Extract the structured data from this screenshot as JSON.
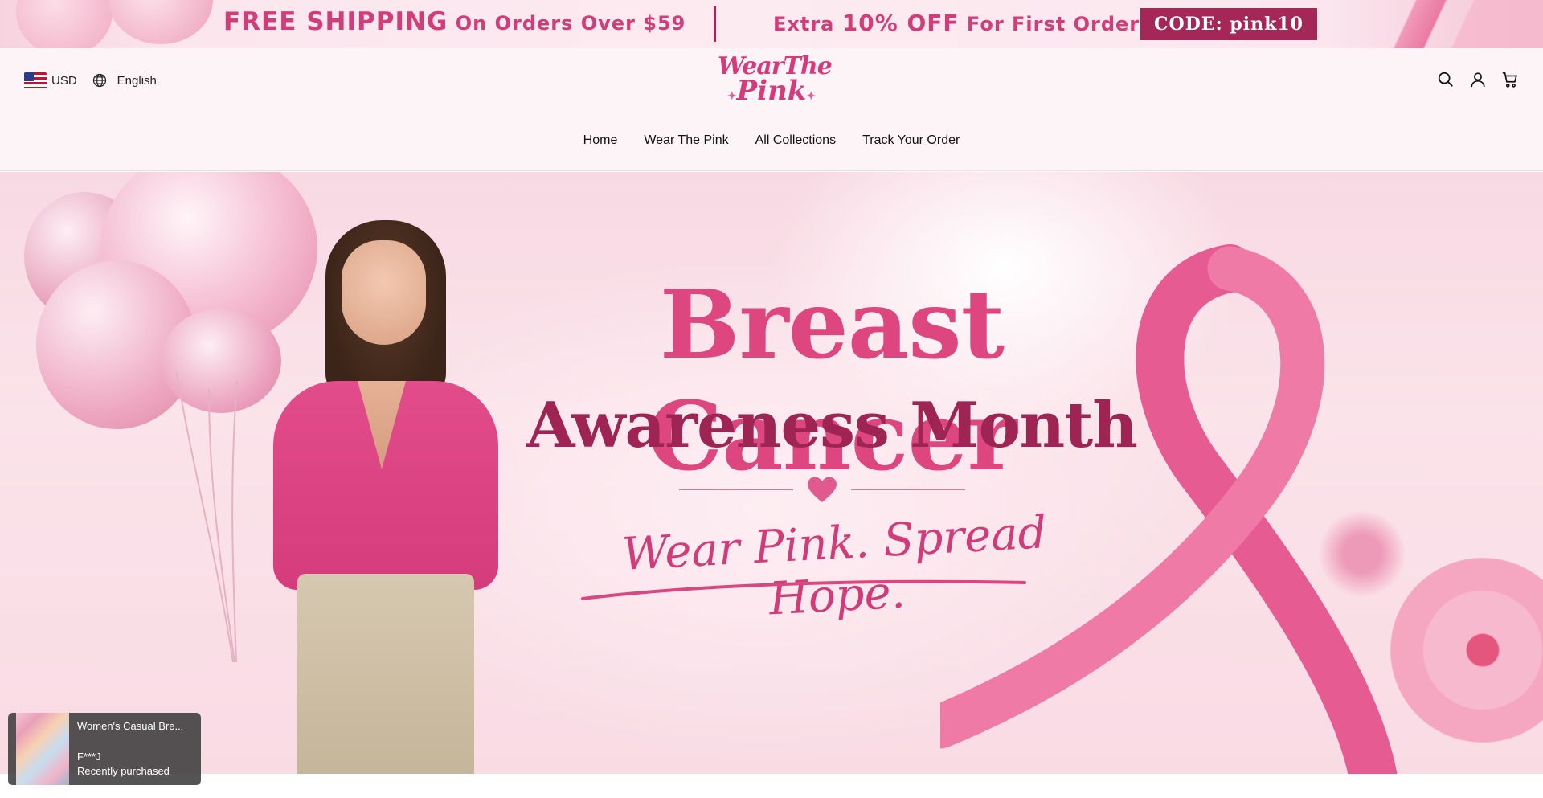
{
  "announcement": {
    "shipping_big": "FREE SHIPPING",
    "shipping_small": " On Orders Over $59",
    "discount_small1": "Extra ",
    "discount_big": "10% OFF",
    "discount_small2": " For First Order",
    "code": "CODE: pink10"
  },
  "header": {
    "currency": "USD",
    "language": "English",
    "logo_line1": "WearThe",
    "logo_line2": "Pink"
  },
  "nav": {
    "items": [
      "Home",
      "Wear The Pink",
      "All Collections",
      "Track Your Order"
    ]
  },
  "hero": {
    "title": "Breast Cancer",
    "subtitle": "Awareness Month",
    "tagline": "Wear Pink. Spread Hope."
  },
  "popup": {
    "product": "Women's Casual Bre...",
    "buyer": "F***J",
    "status": "Recently purchased"
  },
  "colors": {
    "accent": "#d13d78",
    "dark_accent": "#a52757"
  },
  "icons": [
    "us-flag-icon",
    "globe-icon",
    "search-icon",
    "user-icon",
    "cart-icon",
    "heart-icon"
  ]
}
